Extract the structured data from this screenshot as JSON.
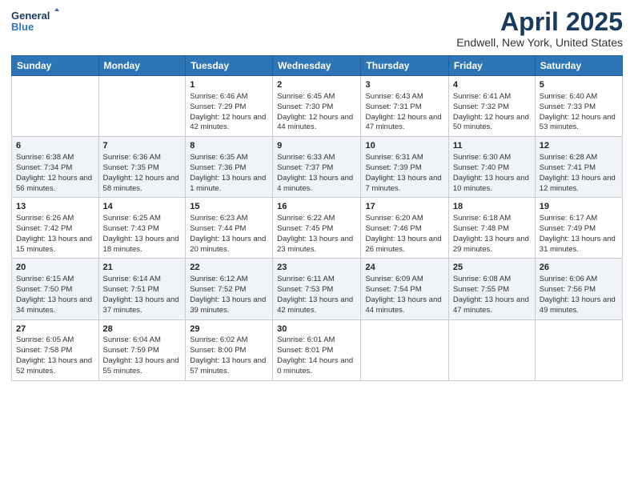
{
  "logo": {
    "line1": "General",
    "line2": "Blue"
  },
  "title": "April 2025",
  "subtitle": "Endwell, New York, United States",
  "days_of_week": [
    "Sunday",
    "Monday",
    "Tuesday",
    "Wednesday",
    "Thursday",
    "Friday",
    "Saturday"
  ],
  "weeks": [
    [
      {
        "day": "",
        "info": ""
      },
      {
        "day": "",
        "info": ""
      },
      {
        "day": "1",
        "info": "Sunrise: 6:46 AM\nSunset: 7:29 PM\nDaylight: 12 hours and 42 minutes."
      },
      {
        "day": "2",
        "info": "Sunrise: 6:45 AM\nSunset: 7:30 PM\nDaylight: 12 hours and 44 minutes."
      },
      {
        "day": "3",
        "info": "Sunrise: 6:43 AM\nSunset: 7:31 PM\nDaylight: 12 hours and 47 minutes."
      },
      {
        "day": "4",
        "info": "Sunrise: 6:41 AM\nSunset: 7:32 PM\nDaylight: 12 hours and 50 minutes."
      },
      {
        "day": "5",
        "info": "Sunrise: 6:40 AM\nSunset: 7:33 PM\nDaylight: 12 hours and 53 minutes."
      }
    ],
    [
      {
        "day": "6",
        "info": "Sunrise: 6:38 AM\nSunset: 7:34 PM\nDaylight: 12 hours and 56 minutes."
      },
      {
        "day": "7",
        "info": "Sunrise: 6:36 AM\nSunset: 7:35 PM\nDaylight: 12 hours and 58 minutes."
      },
      {
        "day": "8",
        "info": "Sunrise: 6:35 AM\nSunset: 7:36 PM\nDaylight: 13 hours and 1 minute."
      },
      {
        "day": "9",
        "info": "Sunrise: 6:33 AM\nSunset: 7:37 PM\nDaylight: 13 hours and 4 minutes."
      },
      {
        "day": "10",
        "info": "Sunrise: 6:31 AM\nSunset: 7:39 PM\nDaylight: 13 hours and 7 minutes."
      },
      {
        "day": "11",
        "info": "Sunrise: 6:30 AM\nSunset: 7:40 PM\nDaylight: 13 hours and 10 minutes."
      },
      {
        "day": "12",
        "info": "Sunrise: 6:28 AM\nSunset: 7:41 PM\nDaylight: 13 hours and 12 minutes."
      }
    ],
    [
      {
        "day": "13",
        "info": "Sunrise: 6:26 AM\nSunset: 7:42 PM\nDaylight: 13 hours and 15 minutes."
      },
      {
        "day": "14",
        "info": "Sunrise: 6:25 AM\nSunset: 7:43 PM\nDaylight: 13 hours and 18 minutes."
      },
      {
        "day": "15",
        "info": "Sunrise: 6:23 AM\nSunset: 7:44 PM\nDaylight: 13 hours and 20 minutes."
      },
      {
        "day": "16",
        "info": "Sunrise: 6:22 AM\nSunset: 7:45 PM\nDaylight: 13 hours and 23 minutes."
      },
      {
        "day": "17",
        "info": "Sunrise: 6:20 AM\nSunset: 7:46 PM\nDaylight: 13 hours and 26 minutes."
      },
      {
        "day": "18",
        "info": "Sunrise: 6:18 AM\nSunset: 7:48 PM\nDaylight: 13 hours and 29 minutes."
      },
      {
        "day": "19",
        "info": "Sunrise: 6:17 AM\nSunset: 7:49 PM\nDaylight: 13 hours and 31 minutes."
      }
    ],
    [
      {
        "day": "20",
        "info": "Sunrise: 6:15 AM\nSunset: 7:50 PM\nDaylight: 13 hours and 34 minutes."
      },
      {
        "day": "21",
        "info": "Sunrise: 6:14 AM\nSunset: 7:51 PM\nDaylight: 13 hours and 37 minutes."
      },
      {
        "day": "22",
        "info": "Sunrise: 6:12 AM\nSunset: 7:52 PM\nDaylight: 13 hours and 39 minutes."
      },
      {
        "day": "23",
        "info": "Sunrise: 6:11 AM\nSunset: 7:53 PM\nDaylight: 13 hours and 42 minutes."
      },
      {
        "day": "24",
        "info": "Sunrise: 6:09 AM\nSunset: 7:54 PM\nDaylight: 13 hours and 44 minutes."
      },
      {
        "day": "25",
        "info": "Sunrise: 6:08 AM\nSunset: 7:55 PM\nDaylight: 13 hours and 47 minutes."
      },
      {
        "day": "26",
        "info": "Sunrise: 6:06 AM\nSunset: 7:56 PM\nDaylight: 13 hours and 49 minutes."
      }
    ],
    [
      {
        "day": "27",
        "info": "Sunrise: 6:05 AM\nSunset: 7:58 PM\nDaylight: 13 hours and 52 minutes."
      },
      {
        "day": "28",
        "info": "Sunrise: 6:04 AM\nSunset: 7:59 PM\nDaylight: 13 hours and 55 minutes."
      },
      {
        "day": "29",
        "info": "Sunrise: 6:02 AM\nSunset: 8:00 PM\nDaylight: 13 hours and 57 minutes."
      },
      {
        "day": "30",
        "info": "Sunrise: 6:01 AM\nSunset: 8:01 PM\nDaylight: 14 hours and 0 minutes."
      },
      {
        "day": "",
        "info": ""
      },
      {
        "day": "",
        "info": ""
      },
      {
        "day": "",
        "info": ""
      }
    ]
  ]
}
